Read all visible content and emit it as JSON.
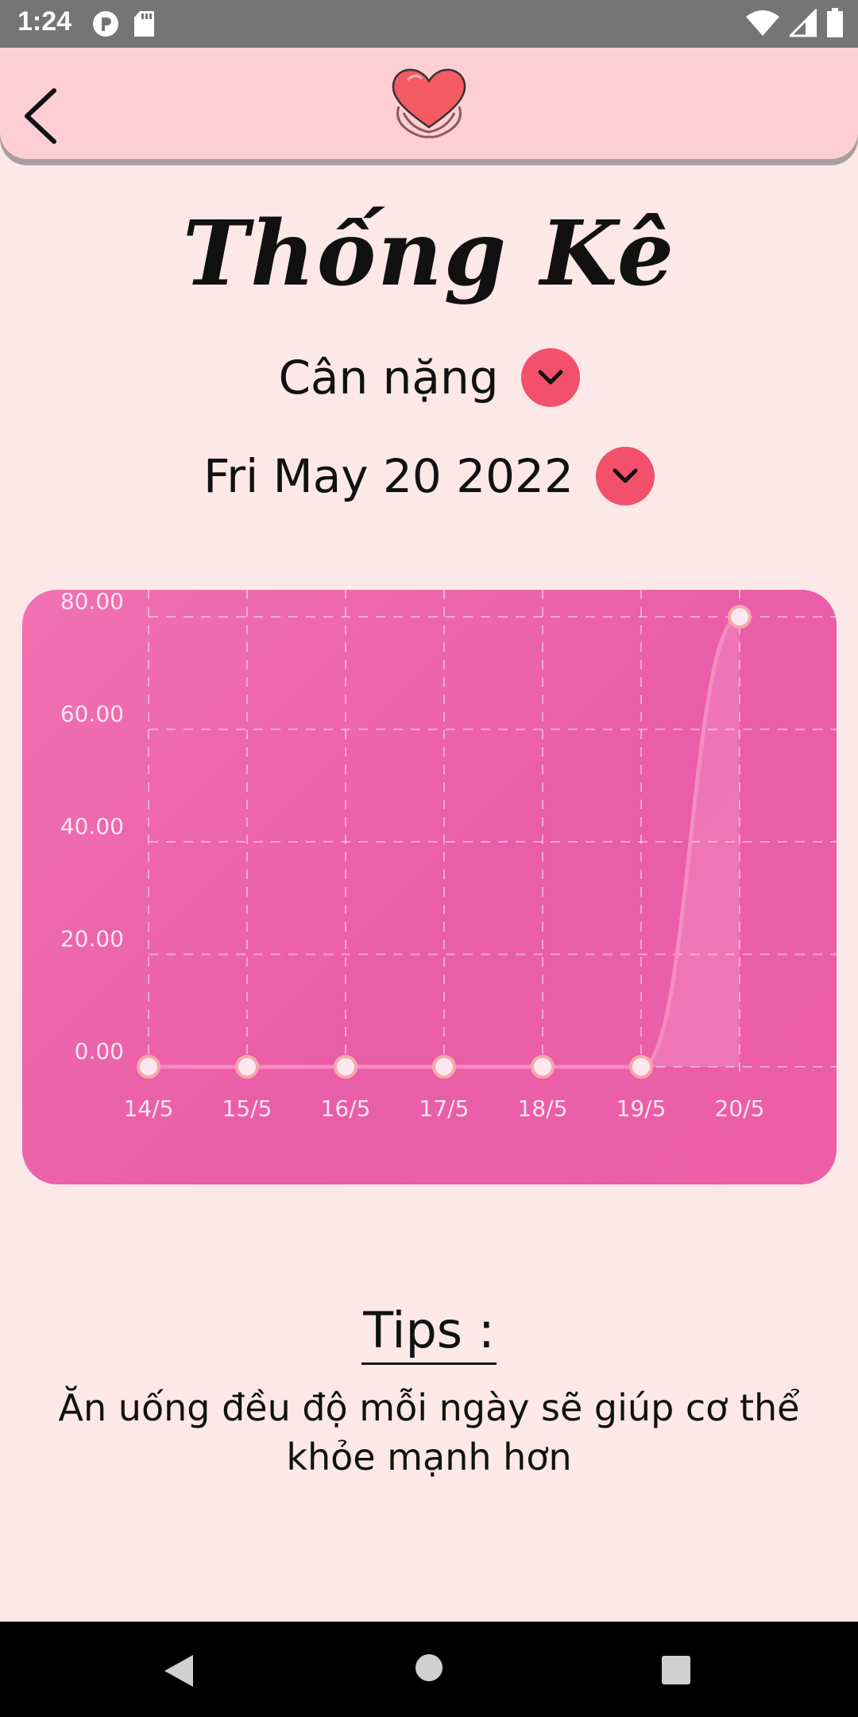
{
  "status_bar": {
    "time": "1:24",
    "icons": [
      "notification-p-icon",
      "sd-card-icon",
      "wifi-icon",
      "signal-icon",
      "battery-icon"
    ]
  },
  "header": {
    "back_icon": "chevron-left-icon",
    "logo_icon": "heart-hands-logo"
  },
  "page": {
    "title": "Thống Kê",
    "metric_selector": "Cân nặng",
    "date_selector": "Fri May 20 2022"
  },
  "chart_data": {
    "type": "line",
    "categories": [
      "14/5",
      "15/5",
      "16/5",
      "17/5",
      "18/5",
      "19/5",
      "20/5"
    ],
    "values": [
      0,
      0,
      0,
      0,
      0,
      0,
      80
    ],
    "y_ticks": [
      "0.00",
      "20.00",
      "40.00",
      "60.00",
      "80.00"
    ],
    "ylim": [
      0,
      80
    ],
    "grid": true,
    "colors": {
      "background": "#ee64ab",
      "line": "#f58cc0",
      "point_fill": "#fde7f0",
      "point_stroke": "#f5a8a8"
    }
  },
  "tips": {
    "title": "Tips :",
    "text": "Ăn uống đều độ mỗi ngày sẽ giúp cơ thể khỏe mạnh hơn"
  },
  "nav_bar": {
    "icons": [
      "back-triangle-icon",
      "home-circle-icon",
      "recents-square-icon"
    ]
  }
}
